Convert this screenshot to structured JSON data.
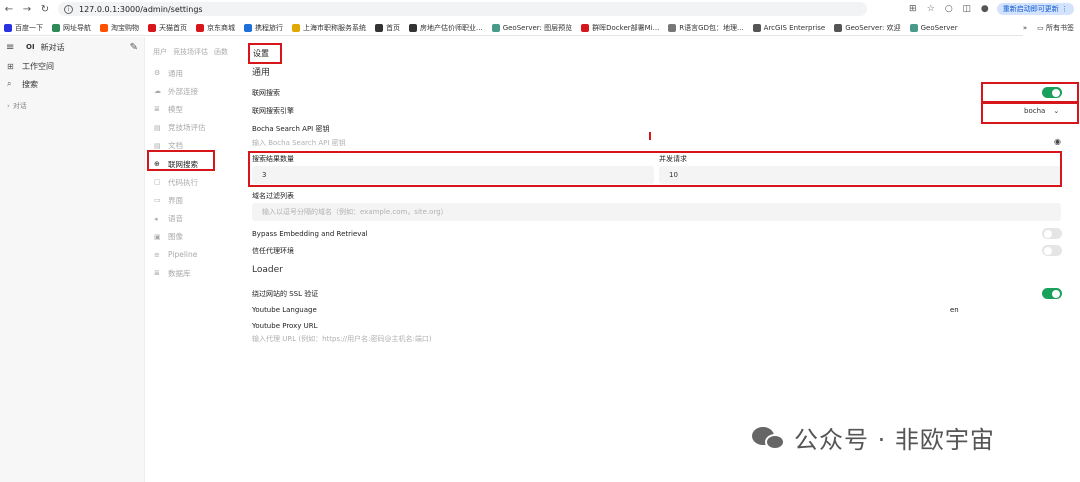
{
  "browser": {
    "url": "127.0.0.1:3000/admin/settings",
    "update_label": "重新启动即可更新",
    "bookmarks": [
      {
        "label": "百度一下",
        "color": "#2932e1"
      },
      {
        "label": "网址导航",
        "color": "#2e8b57"
      },
      {
        "label": "淘宝购物",
        "color": "#ff5000"
      },
      {
        "label": "天猫首页",
        "color": "#d6161b"
      },
      {
        "label": "京东商城",
        "color": "#d6161b"
      },
      {
        "label": "携程旅行",
        "color": "#1e6fd9"
      },
      {
        "label": "上海市职称服务系统",
        "color": "#e0a800"
      },
      {
        "label": "首页",
        "color": "#333333"
      },
      {
        "label": "房地产估价师职业...",
        "color": "#333333"
      },
      {
        "label": "GeoServer: 图层预览",
        "color": "#4a9a8a"
      },
      {
        "label": "群晖Docker部署Mi...",
        "color": "#d6161b"
      },
      {
        "label": "R语言GD包：地理...",
        "color": "#777777"
      },
      {
        "label": "ArcGIS Enterprise",
        "color": "#555555"
      },
      {
        "label": "GeoServer: 欢迎",
        "color": "#555555"
      },
      {
        "label": "GeoServer",
        "color": "#4a9a8a"
      }
    ],
    "more_label": "»",
    "all_bookmarks": "所有书签"
  },
  "sidebar": {
    "logo": "OI",
    "new_chat": "新对话",
    "workspace": "工作空间",
    "search": "搜索",
    "group": "对话"
  },
  "topnav": [
    "用户",
    "竞技场评估",
    "函数"
  ],
  "settings_title": "设置",
  "settings_nav": [
    {
      "label": "通用",
      "icon": "gear-icon",
      "glyph": "⚙",
      "active": false
    },
    {
      "label": "外部连接",
      "icon": "cloud-icon",
      "glyph": "☁",
      "active": false
    },
    {
      "label": "模型",
      "icon": "stack-icon",
      "glyph": "≣",
      "active": false
    },
    {
      "label": "竞技场评估",
      "icon": "doc-icon",
      "glyph": "▤",
      "active": false
    },
    {
      "label": "文档",
      "icon": "file-icon",
      "glyph": "▤",
      "active": false
    },
    {
      "label": "联网搜索",
      "icon": "globe-icon",
      "glyph": "⊕",
      "active": true
    },
    {
      "label": "代码执行",
      "icon": "code-icon",
      "glyph": "▢",
      "active": false
    },
    {
      "label": "界面",
      "icon": "monitor-icon",
      "glyph": "▭",
      "active": false
    },
    {
      "label": "语音",
      "icon": "speaker-icon",
      "glyph": "◂",
      "active": false
    },
    {
      "label": "图像",
      "icon": "image-icon",
      "glyph": "▣",
      "active": false
    },
    {
      "label": "Pipeline",
      "icon": "pipeline-icon",
      "glyph": "≡",
      "active": false
    },
    {
      "label": "数据库",
      "icon": "database-icon",
      "glyph": "≣",
      "active": false
    }
  ],
  "main": {
    "general_heading": "通用",
    "web_search_label": "联网搜索",
    "web_search_enabled": true,
    "engine_label": "联网搜索引擎",
    "engine_value": "bocha",
    "api_key_label": "Bocha Search API 密钥",
    "api_key_placeholder": "输入 Bocha Search API 密钥",
    "result_count_label": "搜索结果数量",
    "result_count_value": "3",
    "concurrency_label": "并发请求",
    "concurrency_value": "10",
    "domain_filter_label": "域名过滤列表",
    "domain_filter_placeholder": "输入以逗号分隔的域名（例如：example.com，site.org）",
    "bypass_label": "Bypass Embedding and Retrieval",
    "bypass_enabled": false,
    "trust_proxy_label": "信任代理环境",
    "trust_proxy_enabled": false,
    "loader_heading": "Loader",
    "ssl_label": "绕过网站的 SSL 验证",
    "ssl_enabled": true,
    "yt_lang_label": "Youtube Language",
    "yt_lang_value": "en",
    "yt_proxy_label": "Youtube Proxy URL",
    "yt_proxy_placeholder": "输入代理 URL (例如：https://用户名:密码@主机名:端口)"
  },
  "watermark": "公众号 · 非欧宇宙"
}
